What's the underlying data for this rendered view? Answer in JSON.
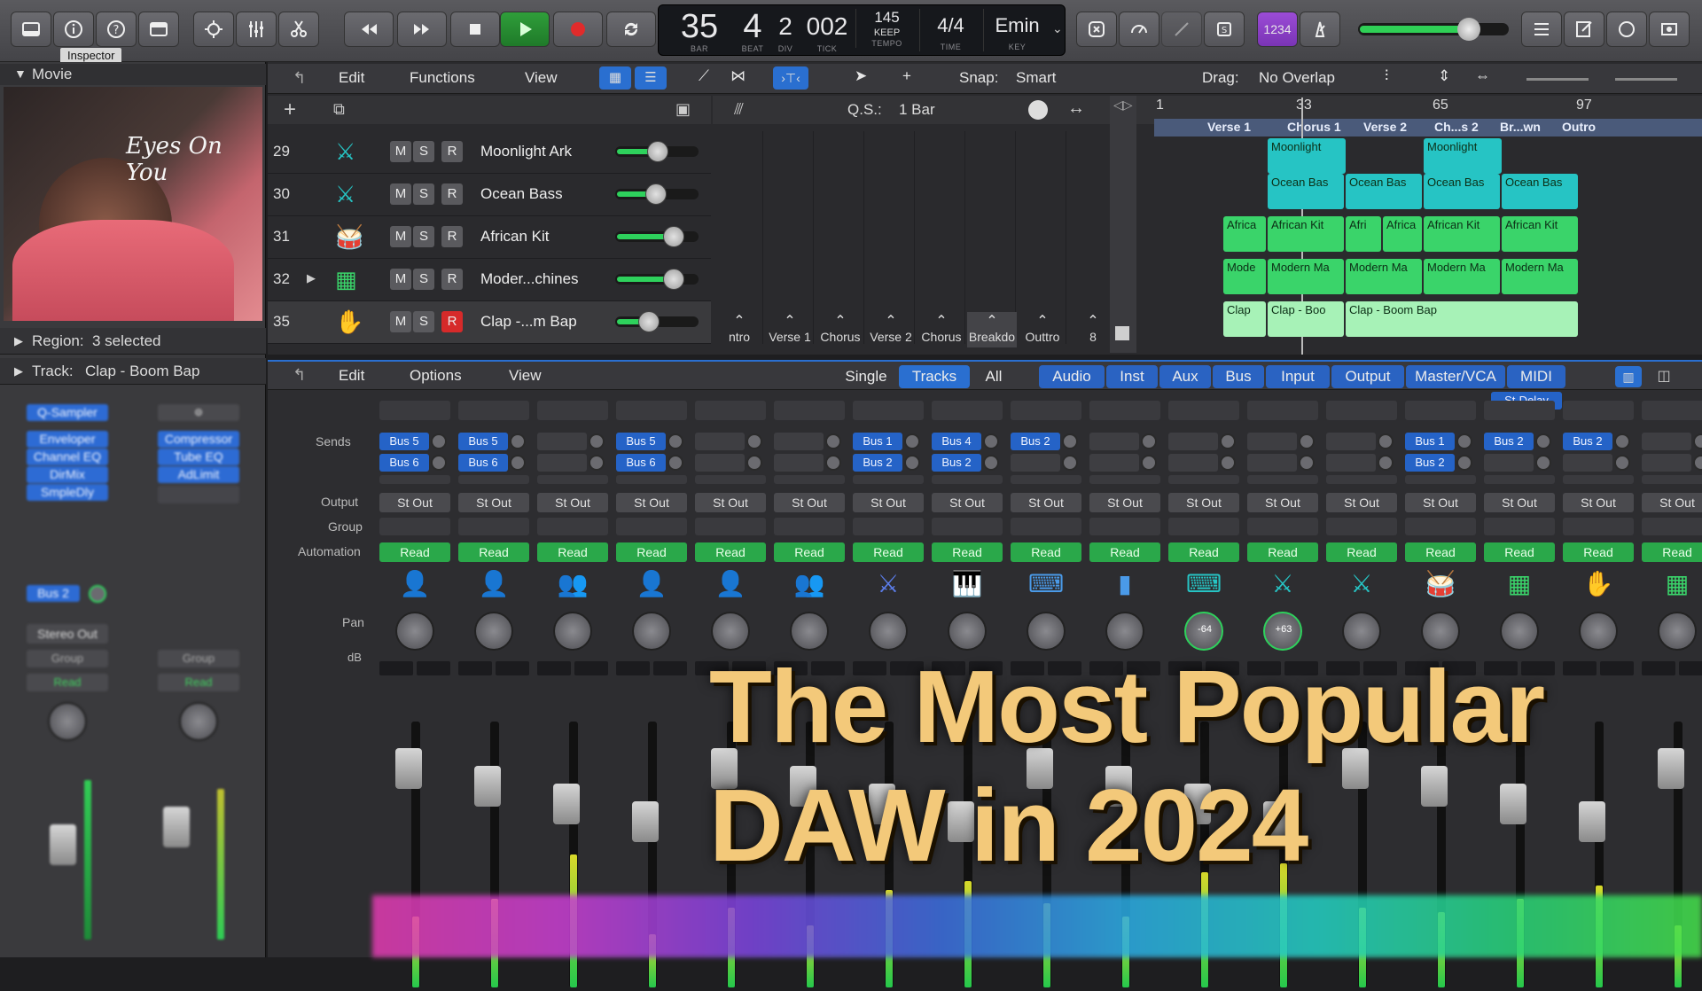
{
  "toolbar": {
    "lcd": {
      "bar": "35",
      "bar_label": "BAR",
      "beat": "4",
      "beat_label": "BEAT",
      "div": "2",
      "div_label": "DIV",
      "tick": "002",
      "tick_label": "TICK",
      "tempo": "145",
      "tempo_mode": "KEEP",
      "tempo_label": "TEMPO",
      "time": "4/4",
      "time_label": "TIME",
      "key": "Emin",
      "key_label": "KEY"
    },
    "count_in": "1234",
    "tooltip": "Inspector"
  },
  "inspector": {
    "movie_header": "Movie",
    "movie_title_art": "Eyes On You",
    "region_label": "Region:",
    "region_value": "3 selected",
    "track_label": "Track:",
    "track_value": "Clap - Boom Bap",
    "plugins_left": [
      "Q-Sampler",
      "Enveloper",
      "Channel EQ",
      "DirMix",
      "SmpleDly"
    ],
    "plugins_right": [
      "Compressor",
      "Tube EQ",
      "AdLimit"
    ],
    "send_left": "Bus 2",
    "output_left": "Stereo Out",
    "group": "Group",
    "read": "Read"
  },
  "tracks_area": {
    "menus": [
      "Edit",
      "Functions",
      "View"
    ],
    "snap_label": "Snap:",
    "snap_value": "Smart",
    "drag_label": "Drag:",
    "drag_value": "No Overlap",
    "qs_label": "Q.S.:",
    "qs_value": "1 Bar",
    "ruler": [
      "1",
      "33",
      "65",
      "97"
    ],
    "markers": [
      "Verse 1",
      "Chorus 1",
      "Verse 2",
      "Ch...s 2",
      "Br...wn",
      "Outro"
    ],
    "tracks": [
      {
        "num": "29",
        "name": "Moonlight Ark",
        "rec": false
      },
      {
        "num": "30",
        "name": "Ocean Bass",
        "rec": false
      },
      {
        "num": "31",
        "name": "African Kit",
        "rec": false
      },
      {
        "num": "32",
        "name": "Moder...chines",
        "rec": false
      },
      {
        "num": "35",
        "name": "Clap -...m Bap",
        "rec": true
      }
    ],
    "m": "M",
    "s": "S",
    "r": "R",
    "sections": [
      "ntro",
      "Verse 1",
      "Chorus",
      "Verse 2",
      "Chorus",
      "Breakdo",
      "Outtro",
      "8"
    ],
    "regions": {
      "moonlight": [
        "Moonlight",
        "Moonlight"
      ],
      "ocean": [
        "Ocean Bas",
        "Ocean Bas",
        "Ocean Bas",
        "Ocean Bas"
      ],
      "african": [
        "Africa",
        "African Kit",
        "Afri",
        "Africa",
        "African Kit",
        "African Kit"
      ],
      "modern": [
        "Mode",
        "Modern Ma",
        "Modern Ma",
        "Modern Ma",
        "Modern Ma"
      ],
      "clap": [
        "Clap",
        "Clap - Boo",
        "Clap - Boom Bap"
      ]
    }
  },
  "mixer": {
    "menus": [
      "Edit",
      "Options",
      "View"
    ],
    "tabs_left": [
      "Single",
      "Tracks",
      "All"
    ],
    "tabs_right": [
      "Audio",
      "Inst",
      "Aux",
      "Bus",
      "Input",
      "Output",
      "Master/VCA",
      "MIDI"
    ],
    "row_labels": {
      "sends": "Sends",
      "output": "Output",
      "group": "Group",
      "automation": "Automation",
      "pan": "Pan",
      "db": "dB"
    },
    "stdelay": "St-Delay",
    "output_value": "St Out",
    "read_value": "Read",
    "strips": [
      {
        "send1": "Bus 5",
        "send2": "Bus 6",
        "icon": "person-pink",
        "pan": ""
      },
      {
        "send1": "Bus 5",
        "send2": "Bus 6",
        "icon": "person-pink",
        "pan": ""
      },
      {
        "send1": "",
        "send2": "",
        "icon": "group-purple",
        "pan": ""
      },
      {
        "send1": "Bus 5",
        "send2": "Bus 6",
        "icon": "person-purple",
        "pan": ""
      },
      {
        "send1": "",
        "send2": "",
        "icon": "person-purple",
        "pan": ""
      },
      {
        "send1": "",
        "send2": "",
        "icon": "group-purple",
        "pan": ""
      },
      {
        "send1": "Bus 1",
        "send2": "Bus 2",
        "icon": "synth-blue",
        "pan": ""
      },
      {
        "send1": "Bus 4",
        "send2": "Bus 2",
        "icon": "piano-blue",
        "pan": ""
      },
      {
        "send1": "Bus 2",
        "send2": "",
        "icon": "keys-blue",
        "pan": ""
      },
      {
        "send1": "",
        "send2": "",
        "icon": "wave-blue",
        "pan": ""
      },
      {
        "send1": "",
        "send2": "",
        "icon": "keys-teal",
        "pan": "-64"
      },
      {
        "send1": "",
        "send2": "",
        "icon": "synth-teal",
        "pan": "+63"
      },
      {
        "send1": "",
        "send2": "",
        "icon": "synth-teal",
        "pan": ""
      },
      {
        "send1": "Bus 1",
        "send2": "Bus 2",
        "icon": "drum-green",
        "pan": ""
      },
      {
        "send1": "Bus 2",
        "send2": "",
        "icon": "machine-green",
        "pan": ""
      },
      {
        "send1": "Bus 2",
        "send2": "",
        "icon": "hand-green",
        "pan": ""
      },
      {
        "send1": "",
        "send2": "",
        "icon": "grid-green",
        "pan": ""
      }
    ]
  },
  "headline": {
    "line1": "The Most Popular",
    "line2": "DAW in 2024"
  },
  "colors": {
    "accent_blue": "#2a6fd0",
    "region_green": "#3ad46a",
    "region_teal": "#26c4c4",
    "headline": "#f3c97a",
    "read_green": "#2aa84a"
  }
}
